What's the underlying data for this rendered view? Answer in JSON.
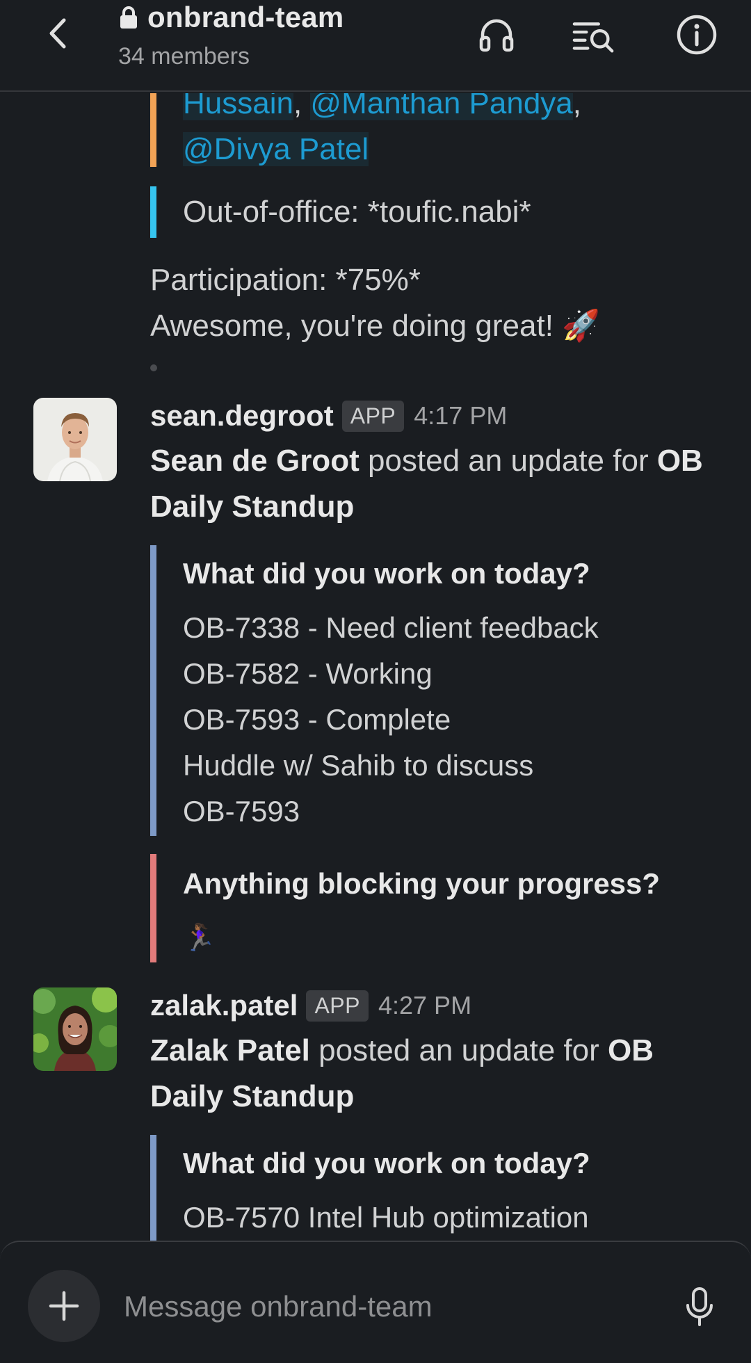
{
  "header": {
    "channel_name": "onbrand-team",
    "members_label": "34 members"
  },
  "feed": {
    "prev_message": {
      "mentions_tail": {
        "part1": "Hussain",
        "sep1": ", ",
        "part2": "@Manthan Pandya",
        "sep2": ",",
        "part3": "@Divya Patel"
      },
      "ooo_text": "Out-of-office: *toufic.nabi*",
      "participation": "Participation: *75%*",
      "encouragement": "Awesome, you're doing great! 🚀"
    },
    "messages": [
      {
        "username": "sean.degroot",
        "badge": "APP",
        "time": "4:17 PM",
        "author_name": "Sean de Groot",
        "posted_text": " posted an update for ",
        "standup_name": "OB Daily Standup",
        "q1_title": "What did you work on today?",
        "q1_lines": [
          "OB-7338 - Need client feedback",
          "OB-7582 - Working",
          "OB-7593 - Complete",
          "Huddle w/ Sahib to discuss",
          "OB-7593"
        ],
        "q2_title": "Anything blocking your progress?",
        "q2_answer": "🏃🏾‍♀️"
      },
      {
        "username": "zalak.patel",
        "badge": "APP",
        "time": "4:27 PM",
        "author_name": "Zalak Patel",
        "posted_text": " posted an update for ",
        "standup_name": "OB Daily Standup",
        "q1_title": "What did you work on today?",
        "q1_lines": [
          "OB-7570 Intel Hub optimization"
        ]
      }
    ]
  },
  "composer": {
    "placeholder": "Message onbrand-team"
  },
  "colors": {
    "background": "#1a1d21",
    "mention": "#1d9bd1",
    "quote_orange": "#f2a356",
    "quote_blue": "#36c5f0",
    "quote_steel": "#7e9ac7",
    "quote_red": "#e27b7b"
  },
  "icons": [
    "chevron-left-icon",
    "lock-icon",
    "headphones-icon",
    "search-list-icon",
    "info-icon",
    "plus-icon",
    "microphone-icon"
  ]
}
